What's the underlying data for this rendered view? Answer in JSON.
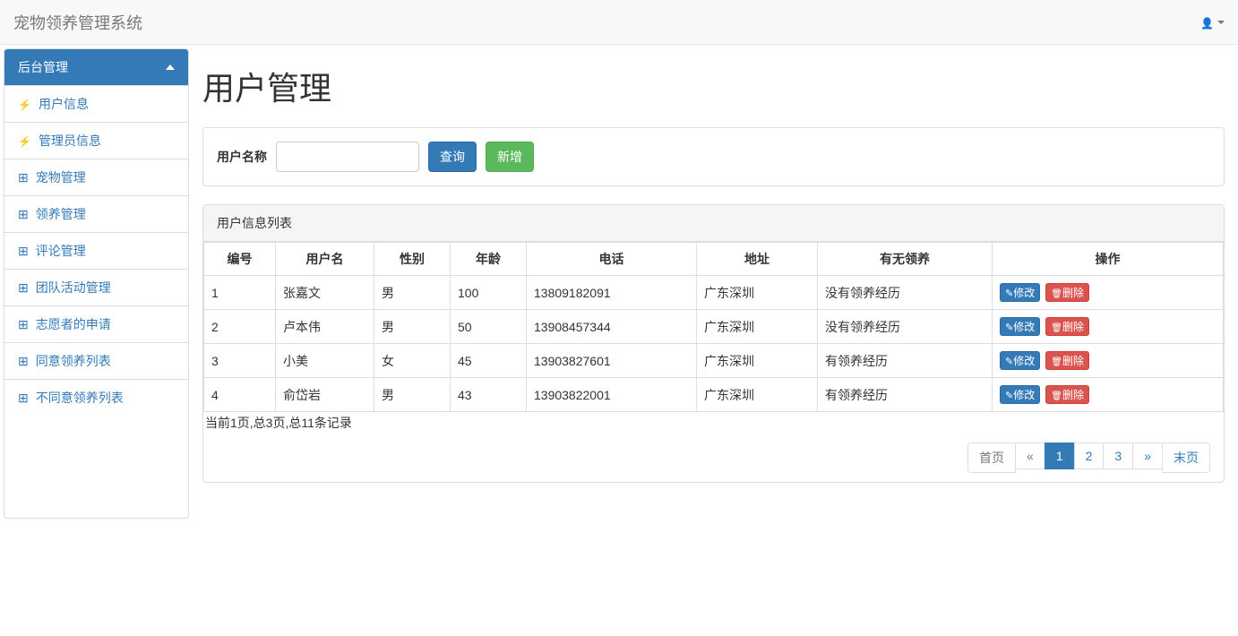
{
  "navbar": {
    "brand": "宠物领养管理系统"
  },
  "sidebar": {
    "heading": "后台管理",
    "items": [
      {
        "icon": "flash",
        "label": "用户信息"
      },
      {
        "icon": "flash",
        "label": "管理员信息"
      },
      {
        "icon": "sitemap",
        "label": "宠物管理"
      },
      {
        "icon": "sitemap",
        "label": "领养管理"
      },
      {
        "icon": "sitemap",
        "label": "评论管理"
      },
      {
        "icon": "sitemap",
        "label": "团队活动管理"
      },
      {
        "icon": "sitemap",
        "label": "志愿者的申请"
      },
      {
        "icon": "sitemap",
        "label": "同意领养列表"
      },
      {
        "icon": "sitemap",
        "label": "不同意领养列表"
      }
    ]
  },
  "page": {
    "title": "用户管理",
    "search_label": "用户名称",
    "search_value": "",
    "query_btn": "查询",
    "add_btn": "新增"
  },
  "table": {
    "heading": "用户信息列表",
    "headers": [
      "编号",
      "用户名",
      "性别",
      "年龄",
      "电话",
      "地址",
      "有无领养",
      "操作"
    ],
    "rows": [
      {
        "id": "1",
        "name": "张嘉文",
        "gender": "男",
        "age": "100",
        "phone": "13809182091",
        "addr": "广东深圳",
        "adopt": "没有领养经历"
      },
      {
        "id": "2",
        "name": "卢本伟",
        "gender": "男",
        "age": "50",
        "phone": "13908457344",
        "addr": "广东深圳",
        "adopt": "没有领养经历"
      },
      {
        "id": "3",
        "name": "小美",
        "gender": "女",
        "age": "45",
        "phone": "13903827601",
        "addr": "广东深圳",
        "adopt": "有领养经历"
      },
      {
        "id": "4",
        "name": "俞岱岩",
        "gender": "男",
        "age": "43",
        "phone": "13903822001",
        "addr": "广东深圳",
        "adopt": "有领养经历"
      }
    ],
    "edit_label": "修改",
    "delete_label": "删除"
  },
  "pagination": {
    "info": "当前1页,总3页,总11条记录",
    "first": "首页",
    "prev": "«",
    "pages": [
      "1",
      "2",
      "3"
    ],
    "active_page": "1",
    "next": "»",
    "last": "末页"
  }
}
